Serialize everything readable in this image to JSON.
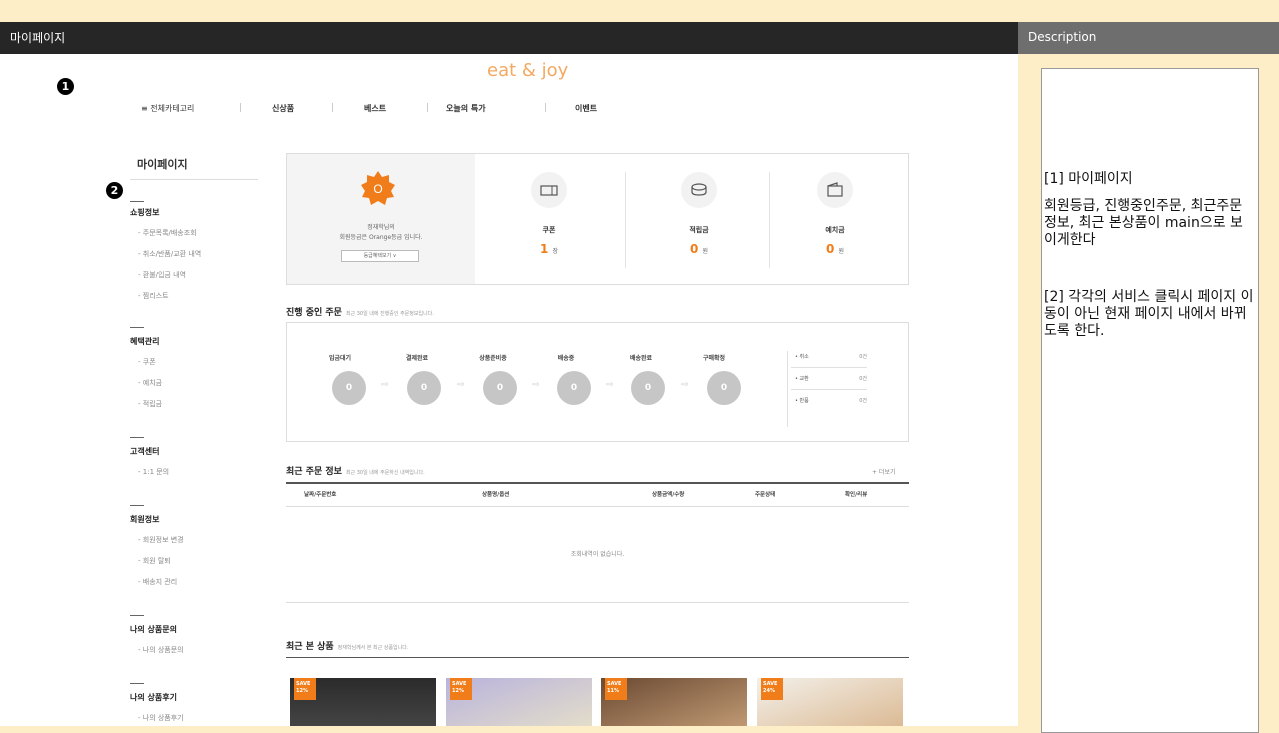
{
  "header": {
    "title": "마이페이지",
    "description_title": "Description"
  },
  "markers": [
    "1",
    "2"
  ],
  "logo": "eat & joy",
  "gnb": {
    "items": [
      "≡ 전체카테고리",
      "신상품",
      "베스트",
      "오늘의 특가",
      "이벤트"
    ]
  },
  "sidebar": {
    "title": "마이페이지",
    "groups": [
      {
        "title": "쇼핑정보",
        "items": [
          "- 주문목록/배송조회",
          "- 취소/반품/교환 내역",
          "- 환불/입금 내역",
          "- 찜리스트"
        ]
      },
      {
        "title": "혜택관리",
        "items": [
          "- 쿠폰",
          "- 예치금",
          "- 적립금"
        ]
      },
      {
        "title": "고객센터",
        "items": [
          "- 1:1 문의"
        ]
      },
      {
        "title": "회원정보",
        "items": [
          "- 회원정보 변경",
          "- 회원 탈퇴",
          "- 배송지 관리"
        ]
      },
      {
        "title": "나의 상품문의",
        "items": [
          "- 나의 상품문의"
        ]
      },
      {
        "title": "나의 상품후기",
        "items": [
          "- 나의 상품후기"
        ]
      }
    ]
  },
  "member": {
    "badge_letter": "O",
    "line1": "정재학님의",
    "line2": "회원등급은 Orange등급 입니다.",
    "grade_button": "등급혜택보기 ∨",
    "stats": [
      {
        "icon": "ticket-icon",
        "label": "쿠폰",
        "value": "1",
        "unit": "장"
      },
      {
        "icon": "coin-icon",
        "label": "적립금",
        "value": "0",
        "unit": "원"
      },
      {
        "icon": "wallet-icon",
        "label": "예치금",
        "value": "0",
        "unit": "원"
      }
    ],
    "badge_color": "#f07d1a"
  },
  "progress": {
    "title": "진행 중인 주문",
    "subtitle": "최근 30일 내에 진행중인 주문정보입니다.",
    "steps": [
      {
        "label": "입금대기",
        "count": "0"
      },
      {
        "label": "결제완료",
        "count": "0"
      },
      {
        "label": "상품준비중",
        "count": "0"
      },
      {
        "label": "배송중",
        "count": "0"
      },
      {
        "label": "배송완료",
        "count": "0"
      },
      {
        "label": "구매확정",
        "count": "0"
      }
    ],
    "status": [
      {
        "label": "• 취소",
        "count": "0건"
      },
      {
        "label": "• 교환",
        "count": "0건"
      },
      {
        "label": "• 반품",
        "count": "0건"
      }
    ]
  },
  "recent_orders": {
    "title": "최근 주문 정보",
    "subtitle": "최근 30일 내에 주문하신 내역입니다.",
    "more": "+ 더보기",
    "columns": [
      "날짜/주문번호",
      "상품명/옵션",
      "상품금액/수량",
      "주문상태",
      "확인/리뷰"
    ],
    "empty": "조회내역이 없습니다."
  },
  "recent_viewed": {
    "title": "최근 본 상품",
    "subtitle": "정재학님께서 본 최근 상품입니다.",
    "products": [
      {
        "save_label": "SAVE",
        "save_pct": "12%"
      },
      {
        "save_label": "SAVE",
        "save_pct": "12%"
      },
      {
        "save_label": "SAVE",
        "save_pct": "11%"
      },
      {
        "save_label": "SAVE",
        "save_pct": "24%"
      }
    ]
  },
  "description": {
    "item1_title": "[1] 마이페이지",
    "item1_body": "회원등급, 진행중인주문, 최근주문정보, 최근 본상품이 main으로 보이게한다",
    "item2_body": "[2] 각각의 서비스 클릭시 페이지 이동이 아닌 현재 페이지 내에서 바뀌도록 한다."
  }
}
